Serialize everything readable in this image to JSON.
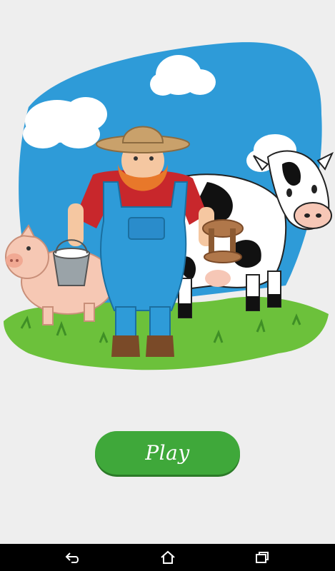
{
  "main": {
    "play_label": "Play"
  },
  "illustration": {
    "subject": "farmer-with-pig-and-cow"
  },
  "nav": {
    "back_icon": "back-icon",
    "home_icon": "home-icon",
    "recents_icon": "recent-apps-icon"
  },
  "colors": {
    "background": "#eeeeee",
    "sky": "#2e9bd8",
    "grass": "#6cc13b",
    "play_button": "#3fa83a",
    "nav_bar": "#000000"
  }
}
